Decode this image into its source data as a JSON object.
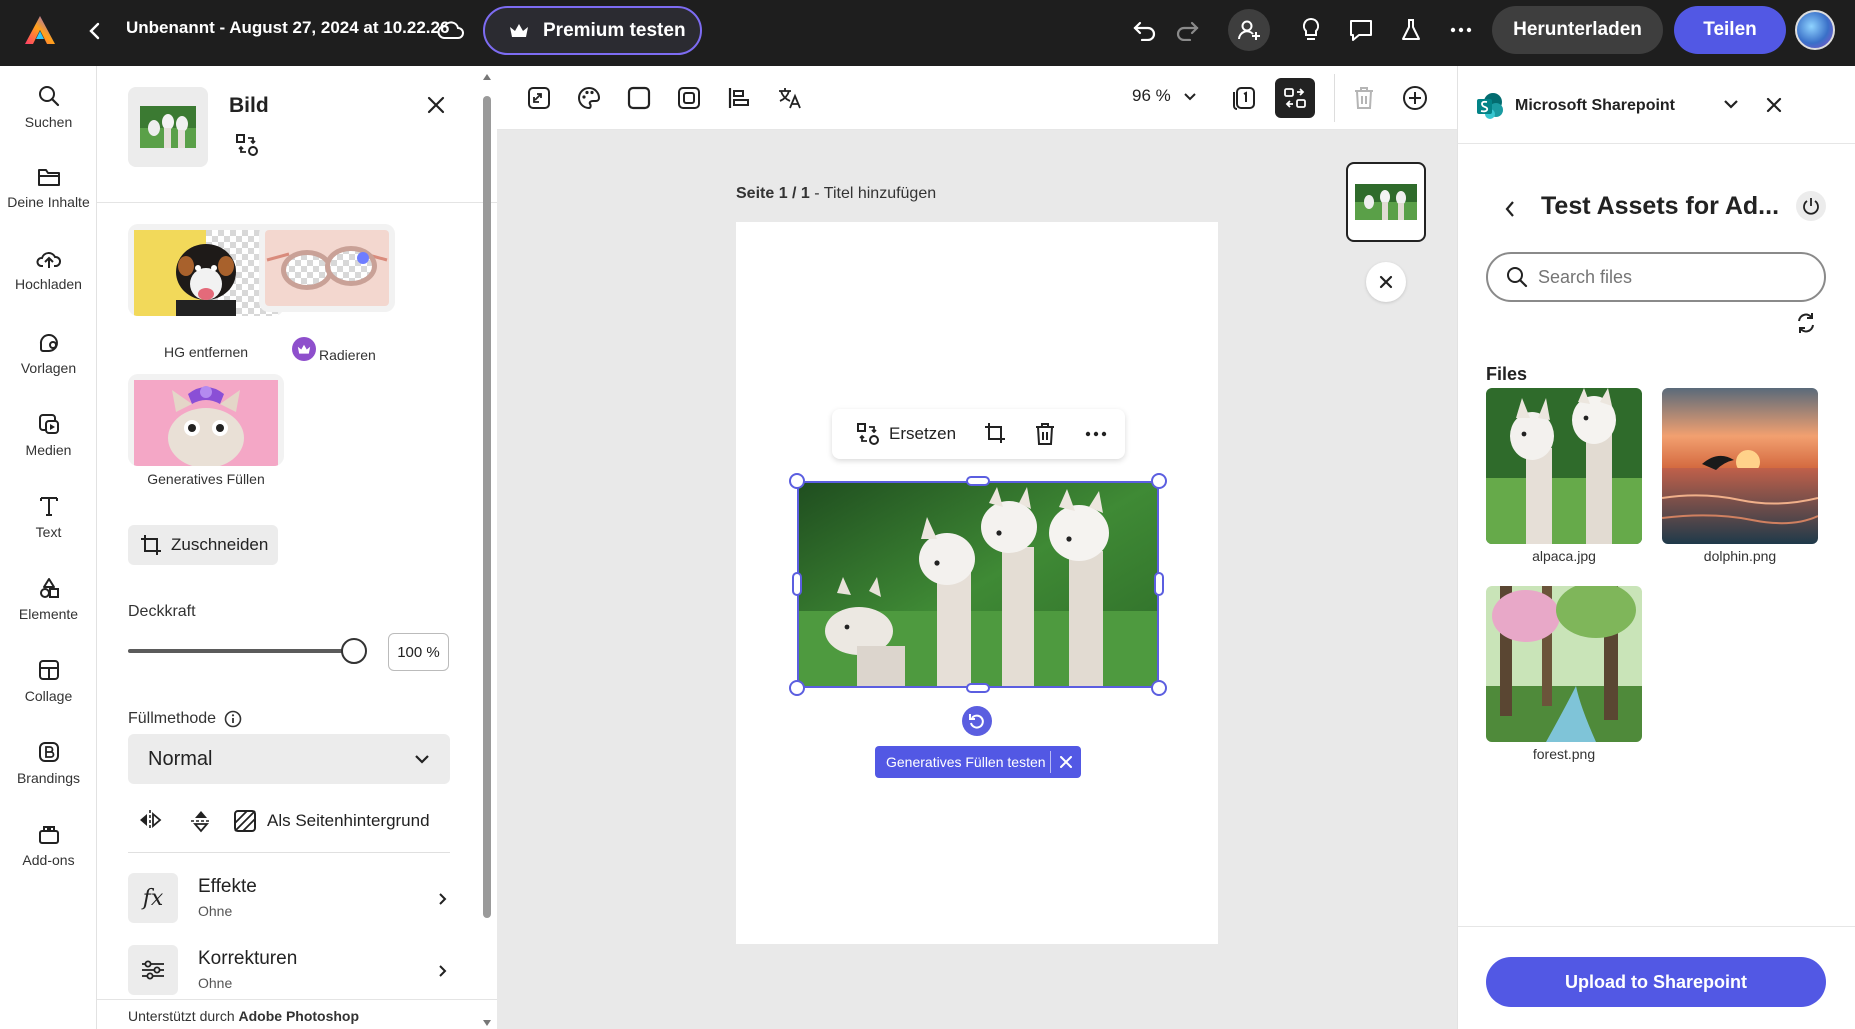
{
  "topbar": {
    "doc_title": "Unbenannt - August 27, 2024 at 10.22.26",
    "premium_label": "Premium testen",
    "download_label": "Herunterladen",
    "share_label": "Teilen"
  },
  "leftrail": {
    "items": [
      {
        "label": "Suchen",
        "icon": "search-icon"
      },
      {
        "label": "Deine Inhalte",
        "icon": "folder-icon"
      },
      {
        "label": "Hochladen",
        "icon": "upload-cloud-icon"
      },
      {
        "label": "Vorlagen",
        "icon": "templates-icon"
      },
      {
        "label": "Medien",
        "icon": "media-icon"
      },
      {
        "label": "Text",
        "icon": "text-icon"
      },
      {
        "label": "Elemente",
        "icon": "elements-icon"
      },
      {
        "label": "Collage",
        "icon": "collage-icon"
      },
      {
        "label": "Brandings",
        "icon": "branding-icon"
      },
      {
        "label": "Add-ons",
        "icon": "addons-icon"
      }
    ]
  },
  "props": {
    "title": "Bild",
    "features": [
      {
        "label": "HG entfernen"
      },
      {
        "label": "Radieren"
      },
      {
        "label": "Generatives Füllen"
      }
    ],
    "crop_label": "Zuschneiden",
    "opacity_label": "Deckkraft",
    "opacity_value": "100 %",
    "opacity_level": 1.0,
    "blend_label": "Füllmethode",
    "blend_value": "Normal",
    "background_label": "Als Seitenhintergrund",
    "effects_title": "Effekte",
    "effects_sub": "Ohne",
    "corrections_title": "Korrekturen",
    "corrections_sub": "Ohne",
    "powered_prefix": "Unterstützt durch",
    "powered_brand": "Adobe Photoshop"
  },
  "canvas": {
    "zoom": "96 %",
    "page_label_bold": "Seite 1 / 1",
    "page_label_rest": " - Titel hinzufügen",
    "context_replace": "Ersetzen",
    "genfill_chip": "Generatives Füllen testen"
  },
  "sharepoint": {
    "app_name": "Microsoft Sharepoint",
    "folder_title": "Test Assets for Ad...",
    "search_placeholder": "Search files",
    "files_heading": "Files",
    "files": [
      {
        "name": "alpaca.jpg"
      },
      {
        "name": "dolphin.png"
      },
      {
        "name": "forest.png"
      }
    ],
    "upload_label": "Upload to Sharepoint"
  },
  "colors": {
    "accent": "#5258e4",
    "topbar_bg": "#1e1e1e",
    "premium_border": "#7d6cf2"
  }
}
